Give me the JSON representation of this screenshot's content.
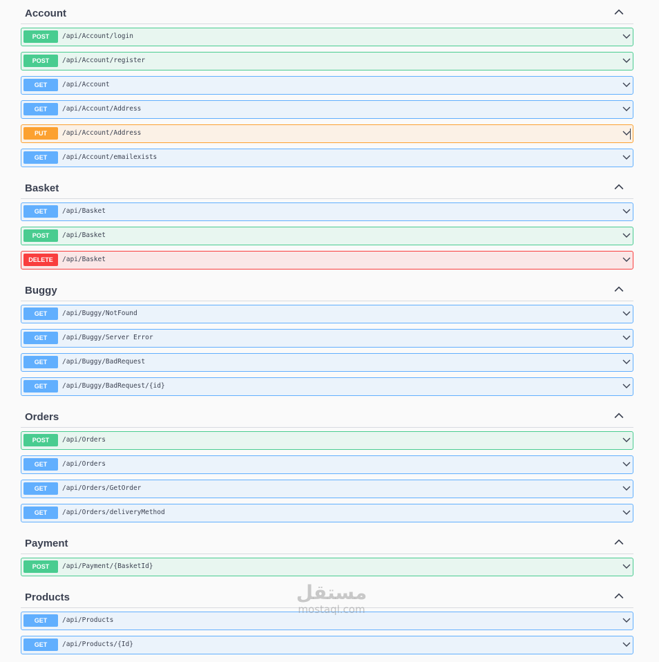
{
  "sections": [
    {
      "title": "Account",
      "operations": [
        {
          "method": "POST",
          "path": "/api/Account/login"
        },
        {
          "method": "POST",
          "path": "/api/Account/register"
        },
        {
          "method": "GET",
          "path": "/api/Account"
        },
        {
          "method": "GET",
          "path": "/api/Account/Address"
        },
        {
          "method": "PUT",
          "path": "/api/Account/Address",
          "cursor": true
        },
        {
          "method": "GET",
          "path": "/api/Account/emailexists"
        }
      ]
    },
    {
      "title": "Basket",
      "operations": [
        {
          "method": "GET",
          "path": "/api/Basket"
        },
        {
          "method": "POST",
          "path": "/api/Basket"
        },
        {
          "method": "DELETE",
          "path": "/api/Basket"
        }
      ]
    },
    {
      "title": "Buggy",
      "operations": [
        {
          "method": "GET",
          "path": "/api/Buggy/NotFound"
        },
        {
          "method": "GET",
          "path": "/api/Buggy/Server Error"
        },
        {
          "method": "GET",
          "path": "/api/Buggy/BadRequest"
        },
        {
          "method": "GET",
          "path": "/api/Buggy/BadRequest/{id}"
        }
      ]
    },
    {
      "title": "Orders",
      "operations": [
        {
          "method": "POST",
          "path": "/api/Orders"
        },
        {
          "method": "GET",
          "path": "/api/Orders"
        },
        {
          "method": "GET",
          "path": "/api/Orders/GetOrder"
        },
        {
          "method": "GET",
          "path": "/api/Orders/deliveryMethod"
        }
      ]
    },
    {
      "title": "Payment",
      "operations": [
        {
          "method": "POST",
          "path": "/api/Payment/{BasketId}"
        }
      ]
    },
    {
      "title": "Products",
      "operations": [
        {
          "method": "GET",
          "path": "/api/Products"
        },
        {
          "method": "GET",
          "path": "/api/Products/{Id}"
        }
      ]
    }
  ],
  "icons": {
    "section_toggle": "chevron-up-icon",
    "operation_toggle": "chevron-down-icon"
  },
  "colors": {
    "POST": "#49cc90",
    "GET": "#61affe",
    "PUT": "#fca130",
    "DELETE": "#f93e3e",
    "text": "#3b4151"
  },
  "watermark": {
    "arabic": "مستقل",
    "latin": "mostaql.com"
  }
}
